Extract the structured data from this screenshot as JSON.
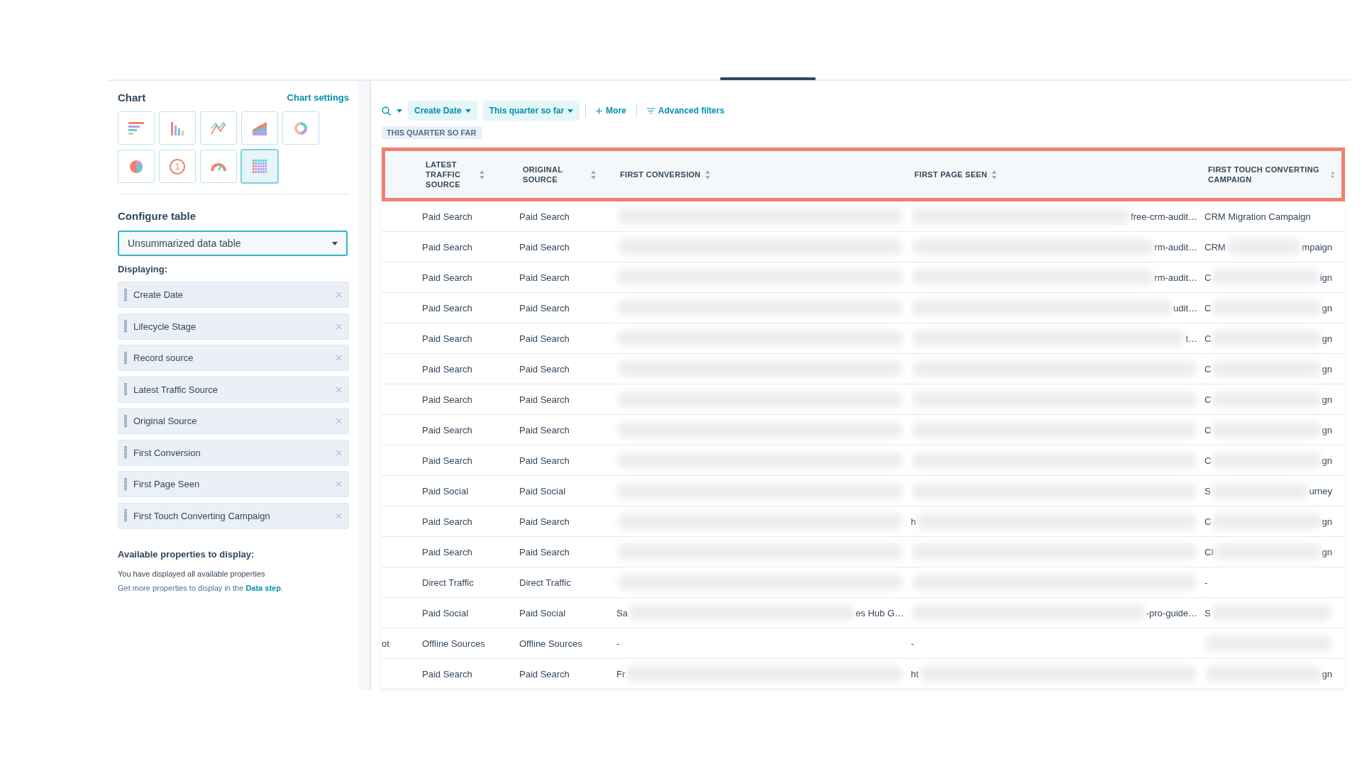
{
  "chart_panel": {
    "title": "Chart",
    "settings_link": "Chart settings",
    "chart_types": [
      {
        "kind": "horizontal-bar",
        "selected": false
      },
      {
        "kind": "vertical-bar",
        "selected": false
      },
      {
        "kind": "line",
        "selected": false
      },
      {
        "kind": "area",
        "selected": false
      },
      {
        "kind": "donut",
        "selected": false
      },
      {
        "kind": "pie",
        "selected": false
      },
      {
        "kind": "kpi",
        "glyph": "1",
        "selected": false
      },
      {
        "kind": "gauge",
        "selected": false
      },
      {
        "kind": "table",
        "selected": true
      }
    ]
  },
  "configure": {
    "title": "Configure table",
    "select_value": "Unsummarized data table",
    "displaying_label": "Displaying:",
    "properties": [
      "Create Date",
      "Lifecycle Stage",
      "Record source",
      "Latest Traffic Source",
      "Original Source",
      "First Conversion",
      "First Page Seen",
      "First Touch Converting Campaign"
    ],
    "available_title": "Available properties to display:",
    "available_note": "You have displayed all available properties",
    "more_text": "Get more properties to display in the ",
    "more_link": "Data step",
    "more_end": "."
  },
  "filters": {
    "chips": [
      "Create Date",
      "This quarter so far"
    ],
    "more": "More",
    "advanced": "Advanced filters",
    "tag": "THIS QUARTER SO FAR"
  },
  "table": {
    "columns": [
      "LATEST TRAFFIC SOURCE",
      "ORIGINAL SOURCE",
      "FIRST CONVERSION",
      "FIRST PAGE SEEN",
      "FIRST TOUCH CONVERTING CAMPAIGN"
    ],
    "rows": [
      {
        "latest": "Paid Search",
        "original": "Paid Search",
        "conversion": {
          "blurred": true
        },
        "page": {
          "blurred": true,
          "end": "free-crm-audit…"
        },
        "campaign": {
          "blurred": false,
          "start": "CRM Migration Campaign"
        }
      },
      {
        "latest": "Paid Search",
        "original": "Paid Search",
        "conversion": {
          "blurred": true
        },
        "page": {
          "blurred": true,
          "end": "rm-audit…"
        },
        "campaign": {
          "blurred": true,
          "start": "CRM",
          "end": "mpaign"
        }
      },
      {
        "latest": "Paid Search",
        "original": "Paid Search",
        "conversion": {
          "blurred": true
        },
        "page": {
          "blurred": true,
          "end": "rm-audit…"
        },
        "campaign": {
          "blurred": true,
          "start": "C",
          "end": "ign"
        }
      },
      {
        "latest": "Paid Search",
        "original": "Paid Search",
        "conversion": {
          "blurred": true
        },
        "page": {
          "blurred": true,
          "end": "udit…"
        },
        "campaign": {
          "blurred": true,
          "start": "C",
          "end": "gn"
        }
      },
      {
        "latest": "Paid Search",
        "original": "Paid Search",
        "conversion": {
          "blurred": true
        },
        "page": {
          "blurred": true,
          "end": "t…"
        },
        "campaign": {
          "blurred": true,
          "start": "C",
          "end": "gn"
        }
      },
      {
        "latest": "Paid Search",
        "original": "Paid Search",
        "conversion": {
          "blurred": true
        },
        "page": {
          "blurred": true
        },
        "campaign": {
          "blurred": true,
          "start": "C",
          "end": "gn"
        }
      },
      {
        "latest": "Paid Search",
        "original": "Paid Search",
        "conversion": {
          "blurred": true
        },
        "page": {
          "blurred": true
        },
        "campaign": {
          "blurred": true,
          "start": "C",
          "end": "gn"
        }
      },
      {
        "latest": "Paid Search",
        "original": "Paid Search",
        "conversion": {
          "blurred": true
        },
        "page": {
          "blurred": true
        },
        "campaign": {
          "blurred": true,
          "start": "C",
          "end": "gn"
        }
      },
      {
        "latest": "Paid Search",
        "original": "Paid Search",
        "conversion": {
          "blurred": true
        },
        "page": {
          "blurred": true
        },
        "campaign": {
          "blurred": true,
          "start": "C",
          "end": "gn"
        }
      },
      {
        "latest": "Paid Social",
        "original": "Paid Social",
        "conversion": {
          "blurred": true
        },
        "page": {
          "blurred": true
        },
        "campaign": {
          "blurred": true,
          "start": "S",
          "end": "urney"
        }
      },
      {
        "latest": "Paid Search",
        "original": "Paid Search",
        "conversion": {
          "blurred": true
        },
        "page": {
          "blurred": true,
          "start": "h"
        },
        "campaign": {
          "blurred": true,
          "start": "C",
          "end": "gn"
        }
      },
      {
        "latest": "Paid Search",
        "original": "Paid Search",
        "conversion": {
          "blurred": true
        },
        "page": {
          "blurred": true
        },
        "campaign": {
          "blurred": true,
          "start": "Cl",
          "end": "gn"
        }
      },
      {
        "latest": "Direct Traffic",
        "original": "Direct Traffic",
        "conversion": {
          "blurred": true
        },
        "page": {
          "blurred": true
        },
        "campaign": {
          "blurred": false,
          "start": "-"
        }
      },
      {
        "latest": "Paid Social",
        "original": "Paid Social",
        "conversion": {
          "blurred": true,
          "start": "Sa",
          "end": "es Hub G…"
        },
        "page": {
          "blurred": true,
          "end": "-pro-guide…"
        },
        "campaign": {
          "blurred": true,
          "start": "S"
        }
      },
      {
        "column_1": "ot",
        "latest": "Offline Sources",
        "original": "Offline Sources",
        "conversion": {
          "blurred": false,
          "start": "-"
        },
        "page": {
          "blurred": false,
          "start": "-"
        },
        "campaign": {
          "blurred": true
        }
      },
      {
        "latest": "Paid Search",
        "original": "Paid Search",
        "conversion": {
          "blurred": true,
          "start": "Fr"
        },
        "page": {
          "blurred": true,
          "start": "ht"
        },
        "campaign": {
          "blurred": true,
          "end": "gn"
        }
      }
    ]
  }
}
